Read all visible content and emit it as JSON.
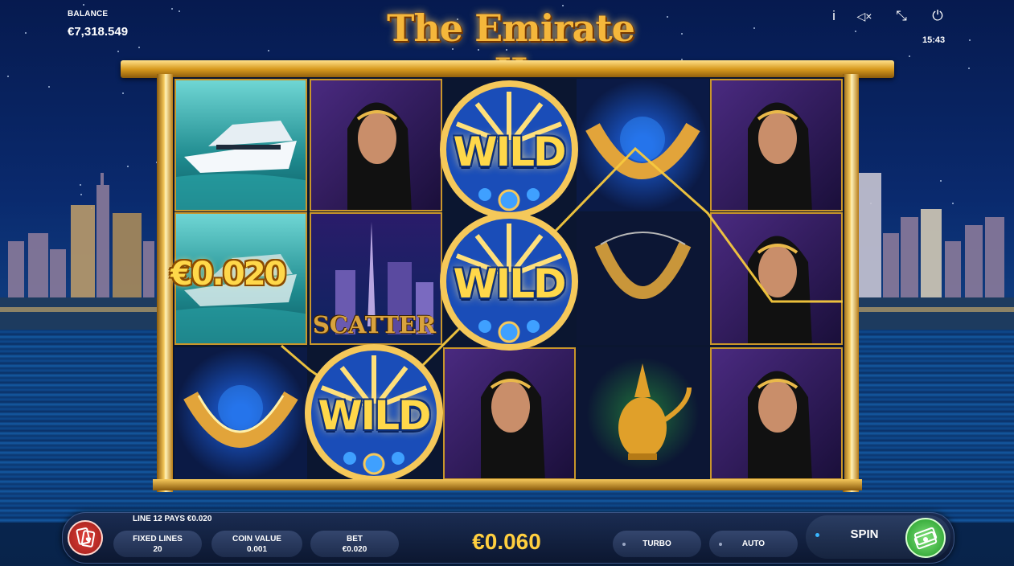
{
  "header": {
    "balance_label": "BALANCE",
    "balance_value": "€7,318.549",
    "game_title": "The Emirate II",
    "clock": "15:43",
    "icons": [
      "info-icon",
      "mute-icon",
      "fullscreen-exit-icon",
      "power-icon"
    ],
    "icon_glyphs": {
      "info": "i",
      "mute": "◁×",
      "fullscreen": "⤡",
      "power": "⏻"
    }
  },
  "reels": {
    "columns": [
      [
        "yacht",
        "yacht",
        "necklace-blue"
      ],
      [
        "woman",
        "city-scatter",
        "wild"
      ],
      [
        "wild",
        "wild",
        "woman"
      ],
      [
        "necklace-blue",
        "necklace-gold",
        "teapot"
      ],
      [
        "woman",
        "woman",
        "woman"
      ]
    ],
    "wild_label": "WILD",
    "scatter_label": "SCATTER",
    "win_amount": "€0.020"
  },
  "controls": {
    "line_pays": "LINE 12 PAYS €0.020",
    "fixed_lines_label": "FIXED LINES",
    "fixed_lines_value": "20",
    "coin_value_label": "COIN VALUE",
    "coin_value": "0.001",
    "bet_label": "BET",
    "bet_value": "€0.020",
    "total_display": "€0.060",
    "turbo_label": "TURBO",
    "auto_label": "AUTO",
    "spin_label": "SPIN"
  },
  "colors": {
    "gold": "#f5c85a",
    "win_yellow": "#ffd84a",
    "spin_green": "#1f9a26",
    "menu_red": "#c42a25"
  }
}
